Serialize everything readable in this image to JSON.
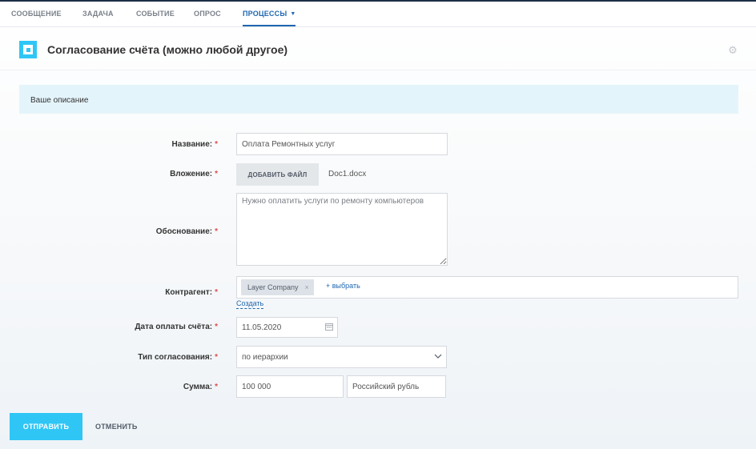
{
  "tabs": {
    "message": "СООБЩЕНИЕ",
    "task": "ЗАДАЧА",
    "event": "СОБЫТИЕ",
    "poll": "ОПРОС",
    "processes": "ПРОЦЕССЫ",
    "processes_caret": "▼"
  },
  "header": {
    "title": "Согласование счёта (можно любой другое)",
    "settings_icon": "gear-icon"
  },
  "description": "Ваше описание",
  "form": {
    "required_mark": "*",
    "name": {
      "label": "Название:",
      "value": "Оплата Ремонтных услуг"
    },
    "attachment": {
      "label": "Вложение:",
      "button": "ДОБАВИТЬ ФАЙЛ",
      "file": "Doc1.docx"
    },
    "justification": {
      "label": "Обоснование:",
      "value": "Нужно оплатить услуги по ремонту компьютеров"
    },
    "counterparty": {
      "label": "Контрагент:",
      "tag": "Layer Company",
      "remove": "×",
      "choose": "+ выбрать",
      "create": "Создать"
    },
    "payment_date": {
      "label": "Дата оплаты счёта:",
      "value": "11.05.2020"
    },
    "approval_type": {
      "label": "Тип согласования:",
      "value": "по иерархии"
    },
    "amount": {
      "label": "Сумма:",
      "value": "100 000",
      "currency": "Российский рубль"
    }
  },
  "footer": {
    "send": "ОТПРАВИТЬ",
    "cancel": "ОТМЕНИТЬ"
  },
  "colors": {
    "accent": "#2fc6f6",
    "link": "#2067b0",
    "required": "#e24d4d",
    "description_bg": "#e4f4fb"
  }
}
